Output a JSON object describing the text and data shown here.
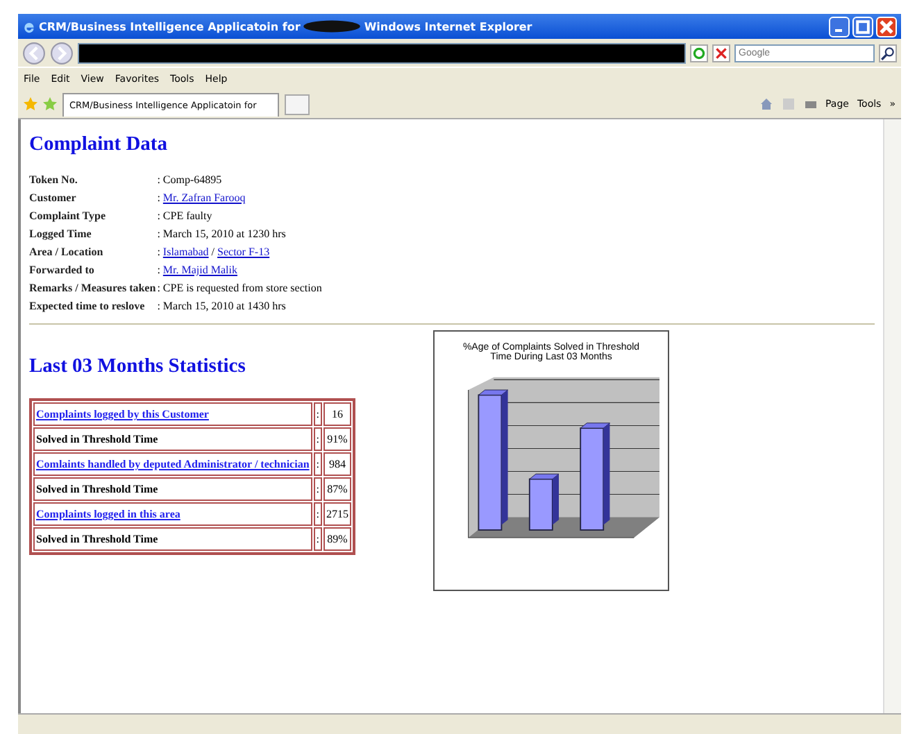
{
  "window": {
    "title_start": "CRM/Business Intelligence Applicatoin for",
    "title_end": "Windows Internet Explorer"
  },
  "search": {
    "placeholder": "Google"
  },
  "menu": [
    "File",
    "Edit",
    "View",
    "Favorites",
    "Tools",
    "Help"
  ],
  "tab": {
    "title": "CRM/Business Intelligence Applicatoin for"
  },
  "command_bar": [
    "Page",
    "Tools",
    "»"
  ],
  "complaint": {
    "heading": "Complaint Data",
    "fields": [
      {
        "label": "Token No.",
        "colon": ":",
        "value": [
          {
            "kind": "text",
            "text": "Comp-64895"
          }
        ]
      },
      {
        "label": "Customer",
        "colon": ":",
        "value": [
          {
            "kind": "link",
            "text": "Mr. Zafran Farooq"
          }
        ]
      },
      {
        "label": "Complaint Type",
        "colon": ":",
        "value": [
          {
            "kind": "text",
            "text": "CPE faulty"
          }
        ]
      },
      {
        "label": "Logged Time",
        "colon": ":",
        "value": [
          {
            "kind": "text",
            "text": "March 15, 2010 at 1230 hrs"
          }
        ]
      },
      {
        "label": "Area / Location",
        "colon": ":",
        "value": [
          {
            "kind": "link",
            "text": "Islamabad"
          },
          {
            "kind": "text",
            "text": "/"
          },
          {
            "kind": "link",
            "text": "Sector F-13"
          }
        ]
      },
      {
        "label": "Forwarded to",
        "colon": ":",
        "value": [
          {
            "kind": "link",
            "text": "Mr. Majid Malik"
          }
        ]
      },
      {
        "label": "Remarks / Measures taken",
        "colon": ":",
        "value": [
          {
            "kind": "text",
            "text": "CPE is requested from store section"
          }
        ]
      },
      {
        "label": "Expected time to reslove",
        "colon": ":",
        "value": [
          {
            "kind": "text",
            "text": "March 15, 2010 at 1430 hrs"
          }
        ]
      }
    ]
  },
  "statistics": {
    "heading": "Last 03 Months Statistics",
    "rows": [
      {
        "kind": "link",
        "label": "Complaints logged by this Customer",
        "colon": ":",
        "value": "16"
      },
      {
        "kind": "text",
        "label": "Solved in Threshold Time",
        "colon": ":",
        "value": "91%"
      },
      {
        "kind": "link",
        "label": "Comlaints handled by deputed Administrator / technician",
        "colon": ":",
        "value": "984"
      },
      {
        "kind": "text",
        "label": "Solved in Threshold Time",
        "colon": ":",
        "value": "87%"
      },
      {
        "kind": "link",
        "label": "Complaints logged in this area",
        "colon": ":",
        "value": "2715"
      },
      {
        "kind": "text",
        "label": "Solved in Threshold Time",
        "colon": ":",
        "value": "89%"
      }
    ]
  },
  "chart": {
    "title": "%Age of Complaints Solved in Threshold Time During Last 03 Months"
  }
}
